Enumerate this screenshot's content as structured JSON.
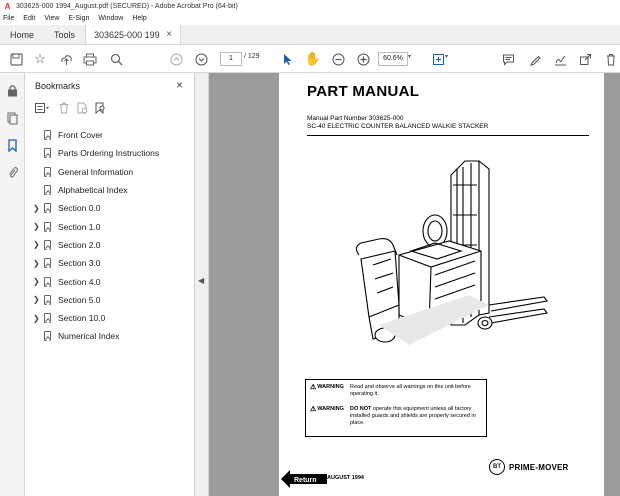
{
  "window": {
    "title": "303625-000 1994_August.pdf (SECURED) - Adobe Acrobat Pro (64-bit)"
  },
  "menu": [
    "File",
    "Edit",
    "View",
    "E-Sign",
    "Window",
    "Help"
  ],
  "tabs": {
    "home": "Home",
    "tools": "Tools",
    "document": "303625-000 1994_..."
  },
  "toolbar": {
    "page_current": "1",
    "page_total": "/ 129",
    "zoom": "60.6%"
  },
  "bookmarks": {
    "title": "Bookmarks",
    "items": [
      {
        "label": "Front Cover",
        "expandable": false
      },
      {
        "label": "Parts Ordering Instructions",
        "expandable": false
      },
      {
        "label": "General Information",
        "expandable": false
      },
      {
        "label": "Alphabetical Index",
        "expandable": false
      },
      {
        "label": "Section 0.0",
        "expandable": true
      },
      {
        "label": "Section 1.0",
        "expandable": true
      },
      {
        "label": "Section 2.0",
        "expandable": true
      },
      {
        "label": "Section 3.0",
        "expandable": true
      },
      {
        "label": "Section 4.0",
        "expandable": true
      },
      {
        "label": "Section 5.0",
        "expandable": true
      },
      {
        "label": "Section 10.0",
        "expandable": true
      },
      {
        "label": "Numerical Index",
        "expandable": false
      }
    ]
  },
  "document": {
    "heading": "PART MANUAL",
    "part_number_line": "Manual Part Number 303625-000",
    "model_line": "SC-40 ELECTRIC COUNTER BALANCED WALKIE STACKER",
    "warnings": [
      {
        "badge": "WARNING",
        "text": "Read and observe all warnings on this unit before operating it.",
        "emphasis": ""
      },
      {
        "badge": "WARNING",
        "text": " operate this equipment unless all factory installed guards and shields are properly secured in place.",
        "emphasis": "DO NOT"
      }
    ],
    "return_label": "Return",
    "date": "AUGUST 1994",
    "brand_logo": "BT",
    "brand_name": "PRIME-MOVER"
  }
}
